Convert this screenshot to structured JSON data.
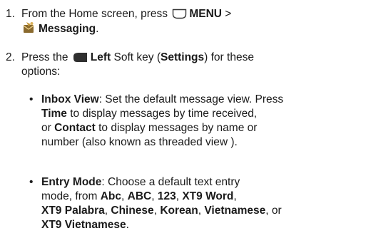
{
  "step1": {
    "number": "1.",
    "l1_pre": "From the Home screen, press",
    "l1_menu": "MENU",
    "l1_gt": ">",
    "l2_messaging": "Messaging",
    "l2_end": "."
  },
  "step2": {
    "number": "2.",
    "l1_pre": "Press the",
    "l1_left": "Left",
    "l1_mid": "Soft key (",
    "l1_settings": "Settings",
    "l1_end": ") for these",
    "l2": "options:"
  },
  "bullet1": {
    "marker": "•",
    "title": "Inbox View",
    "l1_rest": ": Set the default message view. Press",
    "l2_time": "Time",
    "l2_rest": "to display messages by time received,",
    "l3_or": "or",
    "l3_contact": "Contact",
    "l3_rest": "to display messages by name or",
    "l4": "number (also known as threaded view )."
  },
  "bullet2": {
    "marker": "•",
    "title": "Entry Mode",
    "l1_rest": ": Choose a default text entry",
    "l2_pre": "mode, from",
    "abc": "Abc",
    "ABC": "ABC",
    "n123": "123",
    "xt9word": "XT9 Word",
    "xt9palabra": "XT9 Palabra",
    "chinese": "Chinese",
    "korean": "Korean",
    "vietnamese": "Vietnamese",
    "or": "or",
    "xt9viet": "XT9 Vietnamese",
    "comma": ",",
    "period": "."
  },
  "icons": {
    "menu_key": "menu-softkey-icon",
    "left_key": "left-softkey-icon",
    "messaging": "messaging-envelope-icon"
  }
}
